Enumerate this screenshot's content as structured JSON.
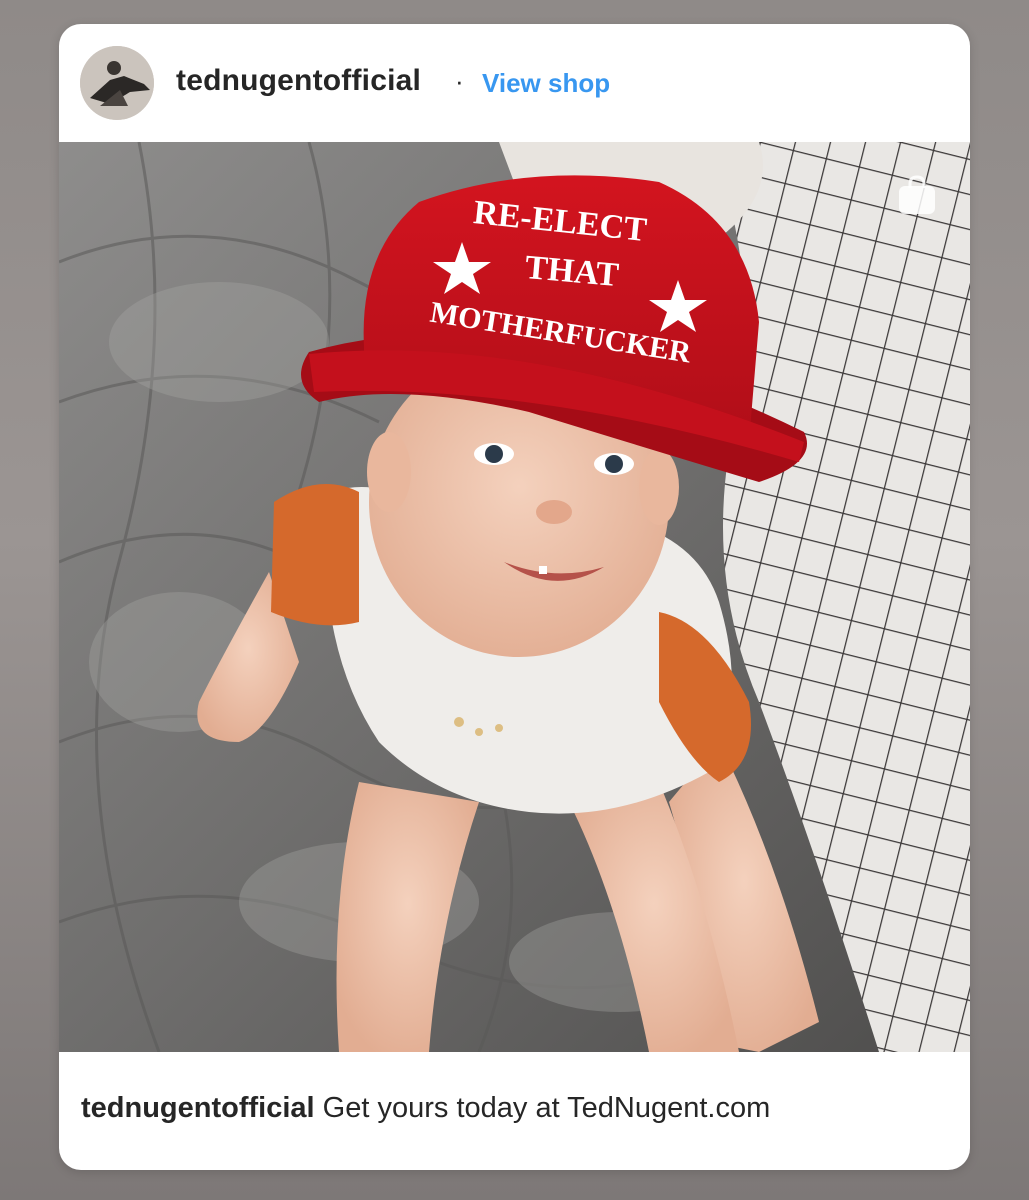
{
  "post": {
    "username": "tednugentofficial",
    "separator": "·",
    "view_shop": "View shop",
    "caption_user": "tednugentofficial",
    "caption_text": "Get yours today at TedNugent.com"
  },
  "photo": {
    "hat_line1": "RE-ELECT",
    "hat_line2": "THAT",
    "hat_line3": "MOTHERFUCKER",
    "hat_color": "#c8121e",
    "shop_icon": "shopping-bag-icon"
  },
  "colors": {
    "link": "#3897f0",
    "text": "#262626"
  }
}
